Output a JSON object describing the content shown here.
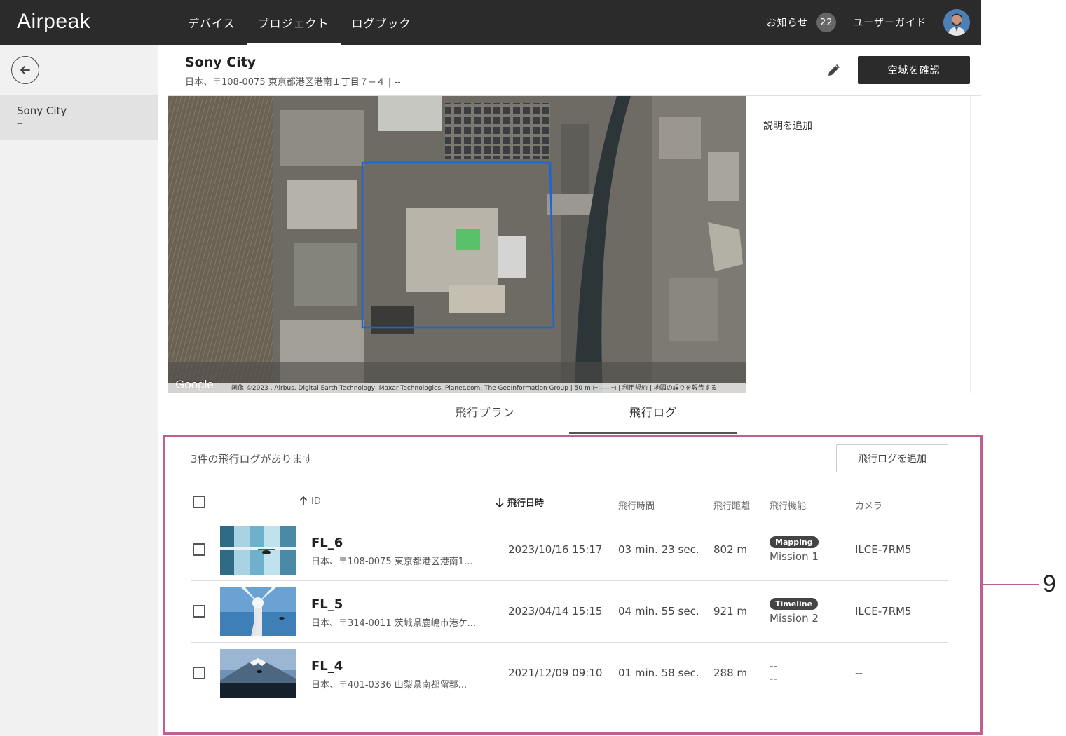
{
  "topbar": {
    "logo": "Airpeak",
    "nav": [
      {
        "label": "デバイス"
      },
      {
        "label": "プロジェクト"
      },
      {
        "label": "ログブック"
      }
    ],
    "notifications_label": "お知らせ",
    "notifications_count": "22",
    "guide_label": "ユーザーガイド"
  },
  "sidebar": {
    "project_name": "Sony City",
    "project_sub": "--"
  },
  "header": {
    "title": "Sony City",
    "address": "日本、〒108-0075 東京都港区港南１丁目７−４ | --",
    "confirm_airspace_label": "空域を確認"
  },
  "map": {
    "google_label": "Google",
    "attribution": "画像 ©2023 , Airbus, Digital Earth Technology, Maxar Technologies, Planet.com, The GeoInformation Group | 50 m ⊢——⊣ | 利用規約 | 地図の誤りを報告する"
  },
  "description": {
    "add_label": "説明を追加"
  },
  "tabs": [
    {
      "label": "飛行プラン"
    },
    {
      "label": "飛行ログ"
    }
  ],
  "logs": {
    "count_text": "3件の飛行ログがあります",
    "add_button_label": "飛行ログを追加",
    "columns": {
      "id": "ID",
      "datetime": "飛行日時",
      "duration": "飛行時間",
      "distance": "飛行距離",
      "feature": "飛行機能",
      "camera": "カメラ"
    },
    "rows": [
      {
        "id": "FL_6",
        "address": "日本、〒108-0075 東京都港区港南1...",
        "datetime": "2023/10/16 15:17",
        "duration": "03 min. 23 sec.",
        "distance": "802 m",
        "feature_badge": "Mapping",
        "mission": "Mission 1",
        "camera": "ILCE-7RM5"
      },
      {
        "id": "FL_5",
        "address": "日本、〒314-0011 茨城県鹿嶋市港ケ...",
        "datetime": "2023/04/14 15:15",
        "duration": "04 min. 55 sec.",
        "distance": "921 m",
        "feature_badge": "Timeline",
        "mission": "Mission 2",
        "camera": "ILCE-7RM5"
      },
      {
        "id": "FL_4",
        "address": "日本、〒401-0336 山梨県南都留郡...",
        "datetime": "2021/12/09 09:10",
        "duration": "01 min. 58 sec.",
        "distance": "288 m",
        "feature_badge": "--",
        "mission": "--",
        "camera": "--"
      }
    ]
  },
  "callout": {
    "number": "9"
  },
  "colors": {
    "topbar": "#2b2b2b",
    "callout": "#c06090",
    "map_frame": "#1a66d9"
  }
}
